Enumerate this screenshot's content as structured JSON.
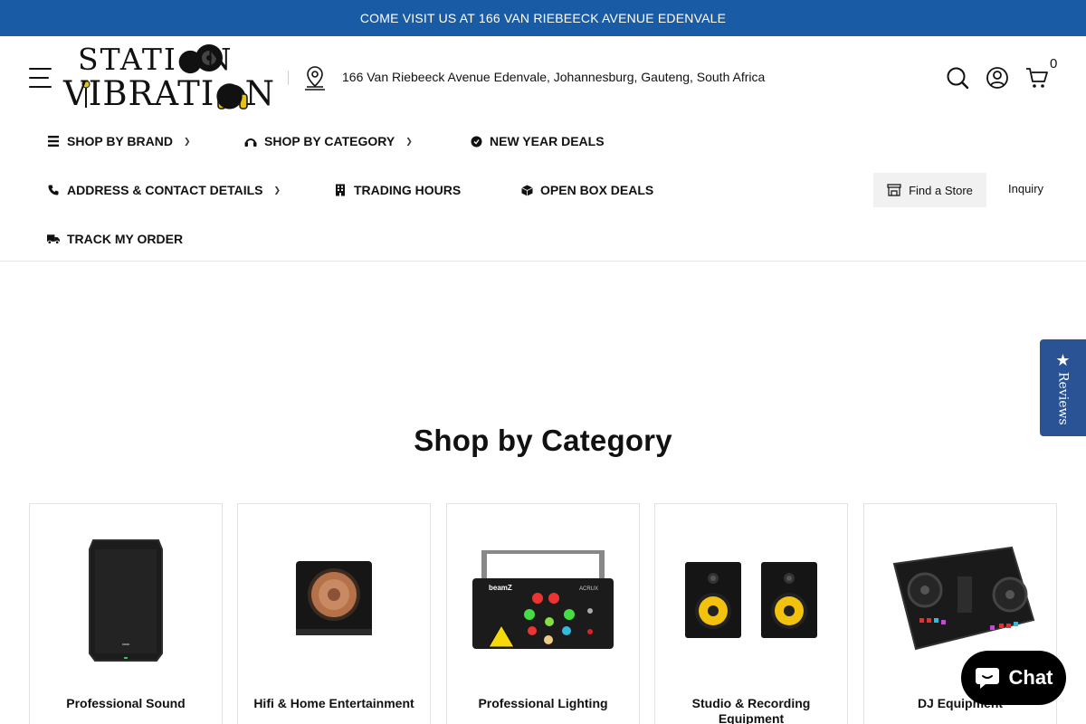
{
  "announcement": "COME VISIT US AT 166 VAN RIEBEECK AVENUE EDENVALE",
  "header": {
    "logo_line1": "STATI●N",
    "logo_line2": "VIBRATI●N",
    "address": "166 Van Riebeeck Avenue Edenvale, Johannesburg, Gauteng, South Africa",
    "cart_count": "0"
  },
  "nav": {
    "shop_by_brand": "SHOP BY BRAND",
    "shop_by_category": "SHOP BY CATEGORY",
    "new_year_deals": "NEW YEAR DEALS",
    "address_contact": "ADDRESS & CONTACT DETAILS",
    "trading_hours": "TRADING HOURS",
    "open_box_deals": "OPEN BOX DEALS",
    "track_order": "TRACK MY ORDER",
    "find_store": "Find a Store",
    "inquiry": "Inquiry"
  },
  "reviews_tab": "Reviews",
  "section_title": "Shop by Category",
  "categories": [
    {
      "label": "Professional Sound"
    },
    {
      "label": "Hifi & Home Entertainment"
    },
    {
      "label": "Professional Lighting"
    },
    {
      "label": "Studio & Recording Equipment"
    },
    {
      "label": "DJ Equipment"
    }
  ],
  "chat": {
    "label": "Chat"
  },
  "colors": {
    "announcement_bg": "#1a5ba6",
    "reviews_bg": "#2a5395",
    "chat_bg": "#000000"
  }
}
